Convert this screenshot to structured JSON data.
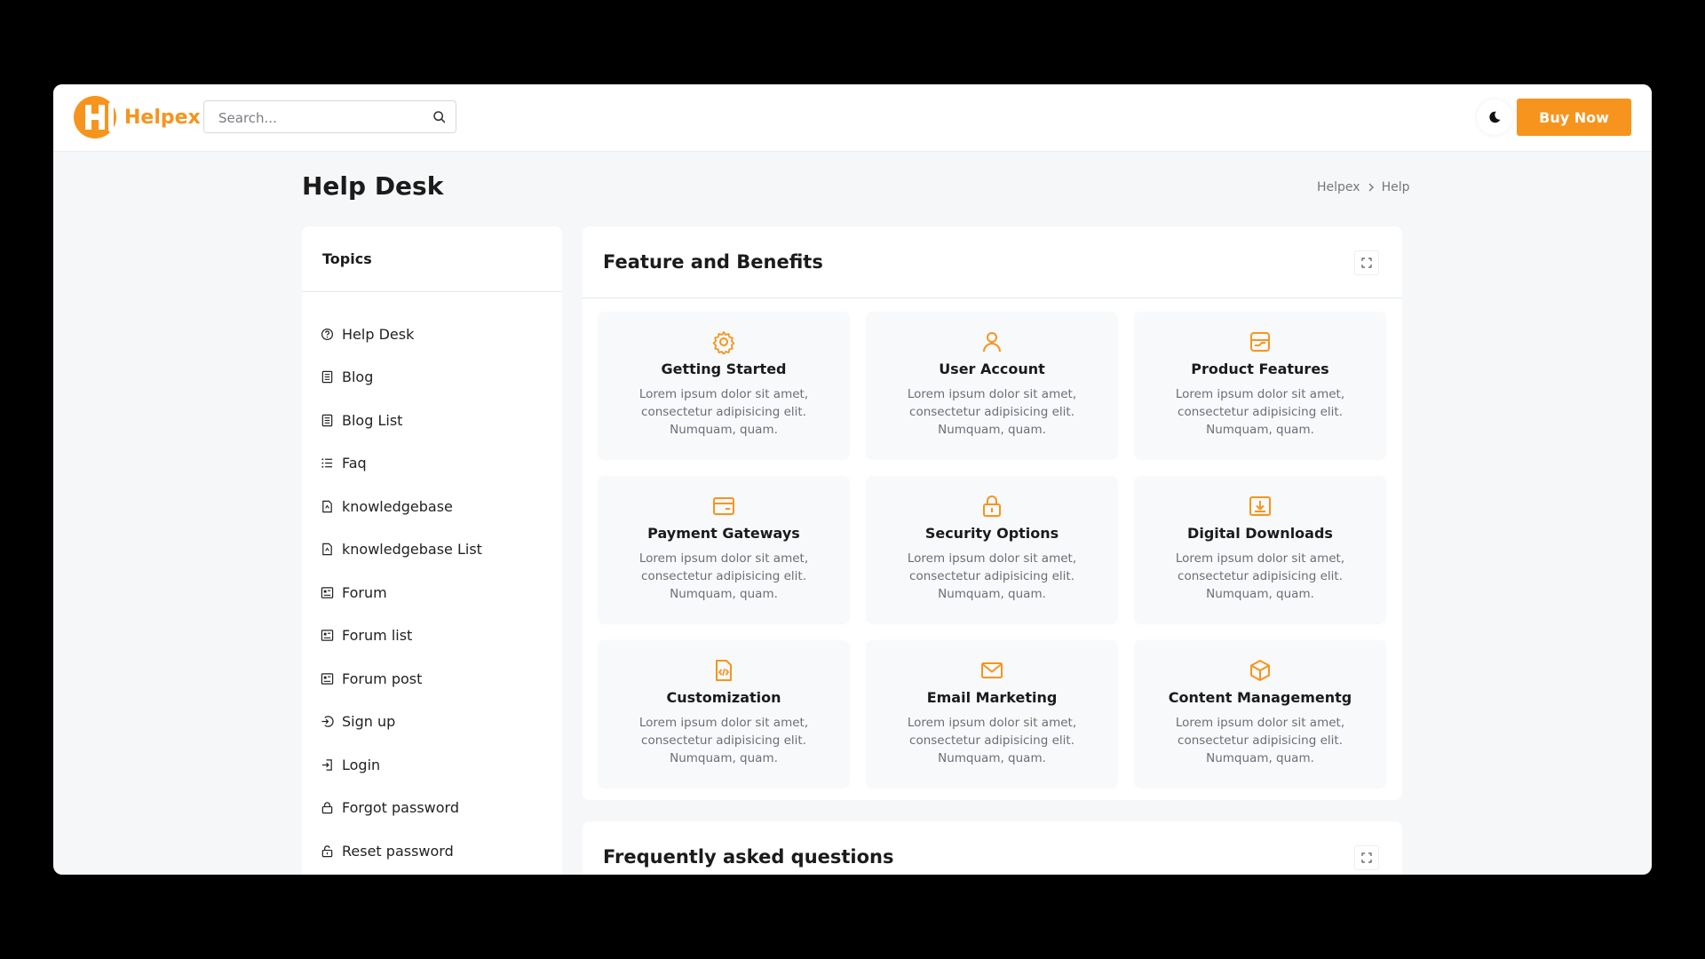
{
  "header": {
    "logo_text": "Helpex",
    "search_placeholder": "Search...",
    "buy_label": "Buy Now"
  },
  "page": {
    "title": "Help Desk",
    "breadcrumb": [
      "Helpex",
      "Help"
    ]
  },
  "sidebar": {
    "title": "Topics",
    "items": [
      {
        "label": "Help Desk",
        "icon": "help-circle-icon"
      },
      {
        "label": "Blog",
        "icon": "document-icon"
      },
      {
        "label": "Blog List",
        "icon": "document-icon"
      },
      {
        "label": "Faq",
        "icon": "list-icon"
      },
      {
        "label": "knowledgebase",
        "icon": "file-icon"
      },
      {
        "label": "knowledgebase List",
        "icon": "file-icon"
      },
      {
        "label": "Forum",
        "icon": "forum-icon"
      },
      {
        "label": "Forum list",
        "icon": "forum-icon"
      },
      {
        "label": "Forum post",
        "icon": "forum-icon"
      },
      {
        "label": "Sign up",
        "icon": "sign-in-icon"
      },
      {
        "label": "Login",
        "icon": "login-icon"
      },
      {
        "label": "Forgot password",
        "icon": "lock-icon"
      },
      {
        "label": "Reset password",
        "icon": "unlock-icon"
      }
    ]
  },
  "features": {
    "title": "Feature and Benefits",
    "cards": [
      {
        "title": "Getting Started",
        "desc": "Lorem ipsum dolor sit amet, consectetur adipisicing elit. Numquam, quam.",
        "icon": "gear-icon"
      },
      {
        "title": "User Account",
        "desc": "Lorem ipsum dolor sit amet, consectetur adipisicing elit. Numquam, quam.",
        "icon": "user-icon"
      },
      {
        "title": "Product Features",
        "desc": "Lorem ipsum dolor sit amet, consectetur adipisicing elit. Numquam, quam.",
        "icon": "product-icon"
      },
      {
        "title": "Payment Gateways",
        "desc": "Lorem ipsum dolor sit amet, consectetur adipisicing elit. Numquam, quam.",
        "icon": "card-icon"
      },
      {
        "title": "Security Options",
        "desc": "Lorem ipsum dolor sit amet, consectetur adipisicing elit. Numquam, quam.",
        "icon": "lock-icon"
      },
      {
        "title": "Digital Downloads",
        "desc": "Lorem ipsum dolor sit amet, consectetur adipisicing elit. Numquam, quam.",
        "icon": "download-icon"
      },
      {
        "title": "Customization",
        "desc": "Lorem ipsum dolor sit amet, consectetur adipisicing elit. Numquam, quam.",
        "icon": "code-file-icon"
      },
      {
        "title": "Email Marketing",
        "desc": "Lorem ipsum dolor sit amet, consectetur adipisicing elit. Numquam, quam.",
        "icon": "mail-icon"
      },
      {
        "title": "Content Managementg",
        "desc": "Lorem ipsum dolor sit amet, consectetur adipisicing elit. Numquam, quam.",
        "icon": "box-icon"
      }
    ]
  },
  "faq": {
    "title": "Frequently asked questions"
  },
  "colors": {
    "accent": "#f7941d",
    "background": "#f6f7f9"
  }
}
